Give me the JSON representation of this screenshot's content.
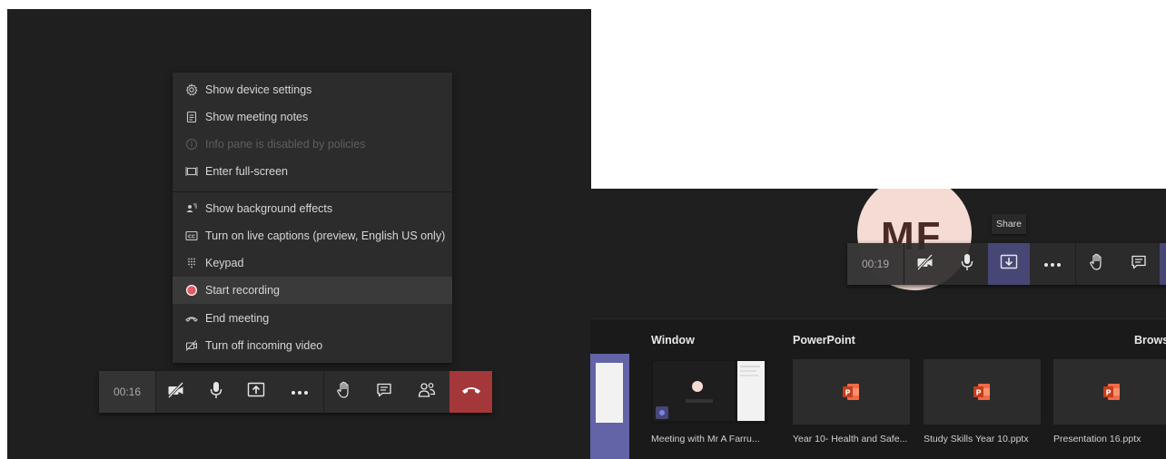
{
  "menu": {
    "items": [
      {
        "label": "Show device settings",
        "icon": "gear-icon"
      },
      {
        "label": "Show meeting notes",
        "icon": "notes-icon"
      },
      {
        "label": "Info pane is disabled by policies",
        "icon": "info-icon",
        "disabled": true
      },
      {
        "label": "Enter full-screen",
        "icon": "fullscreen-icon"
      },
      {
        "label": "Show background effects",
        "icon": "background-effects-icon"
      },
      {
        "label": "Turn on live captions (preview, English US only)",
        "icon": "captions-icon"
      },
      {
        "label": "Keypad",
        "icon": "keypad-icon"
      },
      {
        "label": "Start recording",
        "icon": "record-icon",
        "highlighted": true
      },
      {
        "label": "End meeting",
        "icon": "end-meeting-icon"
      },
      {
        "label": "Turn off incoming video",
        "icon": "video-off-icon"
      }
    ]
  },
  "left_toolbar": {
    "timer": "00:16",
    "buttons": [
      "camera-off-icon",
      "microphone-icon",
      "share-tray-icon",
      "more-options-icon",
      "raise-hand-icon",
      "chat-icon",
      "participants-icon",
      "hang-up-icon"
    ]
  },
  "right_toolbar": {
    "timer": "00:19",
    "avatar_initials": "MF",
    "share_tooltip": "Share",
    "buttons": [
      "camera-off-icon",
      "microphone-icon",
      "share-icon",
      "more-options-icon",
      "raise-hand-icon",
      "chat-icon"
    ]
  },
  "share_tray": {
    "window_header": "Window",
    "powerpoint_header": "PowerPoint",
    "browse_header": "Brows",
    "window_item": {
      "caption": "Meeting with Mr A Farru..."
    },
    "ppt_items": [
      {
        "caption": "Year 10- Health and Safe..."
      },
      {
        "caption": "Study Skills Year 10.pptx"
      },
      {
        "caption": "Presentation 16.pptx"
      }
    ]
  },
  "colors": {
    "background": "#201f1f",
    "menu_bg": "#2d2c2c",
    "hangup": "#a4373a",
    "share_highlight": "#464775",
    "record_dot": "#e25b63",
    "avatar_bg": "#f4dbd4",
    "powerpoint": "#c43e1c"
  }
}
